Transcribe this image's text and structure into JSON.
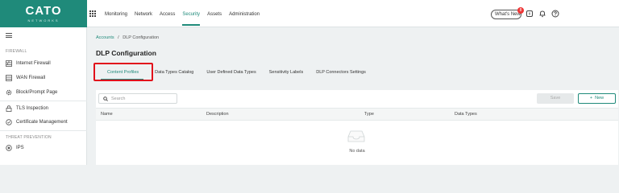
{
  "logo": {
    "text": "CATO",
    "subtext": "NETWORKS",
    "color": "#1f8a7a"
  },
  "topnav": {
    "items": [
      {
        "label": "Monitoring"
      },
      {
        "label": "Network"
      },
      {
        "label": "Access"
      },
      {
        "label": "Security",
        "active": true
      },
      {
        "label": "Assets"
      },
      {
        "label": "Administration"
      }
    ],
    "whats_new": "What's New",
    "badge_count": "8"
  },
  "sidebar": {
    "section_firewall": "FIREWALL",
    "items_firewall": [
      {
        "label": "Internet Firewall",
        "icon": "internet-firewall-icon"
      },
      {
        "label": "WAN Firewall",
        "icon": "wan-firewall-icon"
      },
      {
        "label": "Block/Prompt Page",
        "icon": "gear-icon"
      }
    ],
    "items_tls": [
      {
        "label": "TLS Inspection",
        "icon": "lock-icon"
      },
      {
        "label": "Certificate Management",
        "icon": "certificate-icon"
      }
    ],
    "section_threat": "THREAT PREVENTION",
    "items_threat": [
      {
        "label": "IPS",
        "icon": "ips-icon"
      }
    ]
  },
  "breadcrumb": {
    "parent": "Accounts",
    "separator": "/",
    "current": "DLP Configuration"
  },
  "page_title": "DLP Configuration",
  "tabs": [
    {
      "label": "Content Profiles",
      "active": true
    },
    {
      "label": "Data Types Catalog"
    },
    {
      "label": "User Defined Data Types"
    },
    {
      "label": "Sensitivity Labels"
    },
    {
      "label": "DLP Connectors Settings"
    }
  ],
  "toolbar": {
    "search_placeholder": "Search",
    "save_label": "Save",
    "new_label": "New",
    "new_icon": "+"
  },
  "table": {
    "columns": [
      "Name",
      "Description",
      "Type",
      "Data Types"
    ],
    "empty_text": "No data"
  },
  "colors": {
    "accent": "#1f8a7a",
    "highlight": "#e1101b",
    "badge": "#e33333"
  }
}
